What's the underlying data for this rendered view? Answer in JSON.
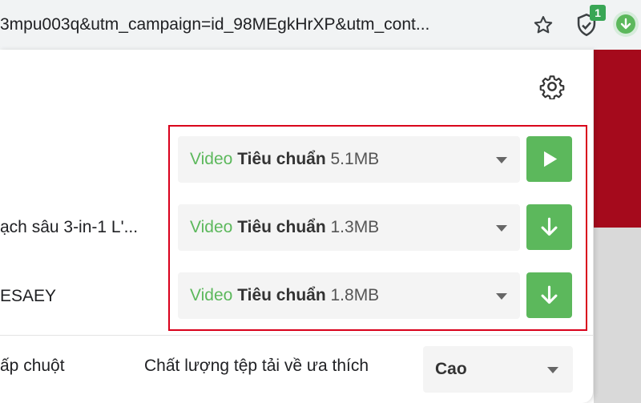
{
  "browser": {
    "url_text": "3mpu003q&utm_campaign=id_98MEgkHrXP&utm_cont...",
    "extension_badge": "1"
  },
  "popup": {
    "items": [
      {
        "title": "",
        "type": "Video",
        "quality": "Tiêu chuẩn",
        "size": "5.1MB",
        "action": "play-icon"
      },
      {
        "title": "ạch sâu 3-in-1 L'...",
        "type": "Video",
        "quality": "Tiêu chuẩn",
        "size": "1.3MB",
        "action": "download-icon"
      },
      {
        "title": "ESAEY",
        "type": "Video",
        "quality": "Tiêu chuẩn",
        "size": "1.8MB",
        "action": "download-icon"
      }
    ],
    "footer": {
      "left_text": "ấp chuột",
      "preference_label": "Chất lượng tệp tải về ưa thích",
      "preference_value": "Cao"
    }
  },
  "colors": {
    "accent_green": "#5cb85c",
    "highlight_red": "#d9001b",
    "page_red": "#a50a1c"
  }
}
